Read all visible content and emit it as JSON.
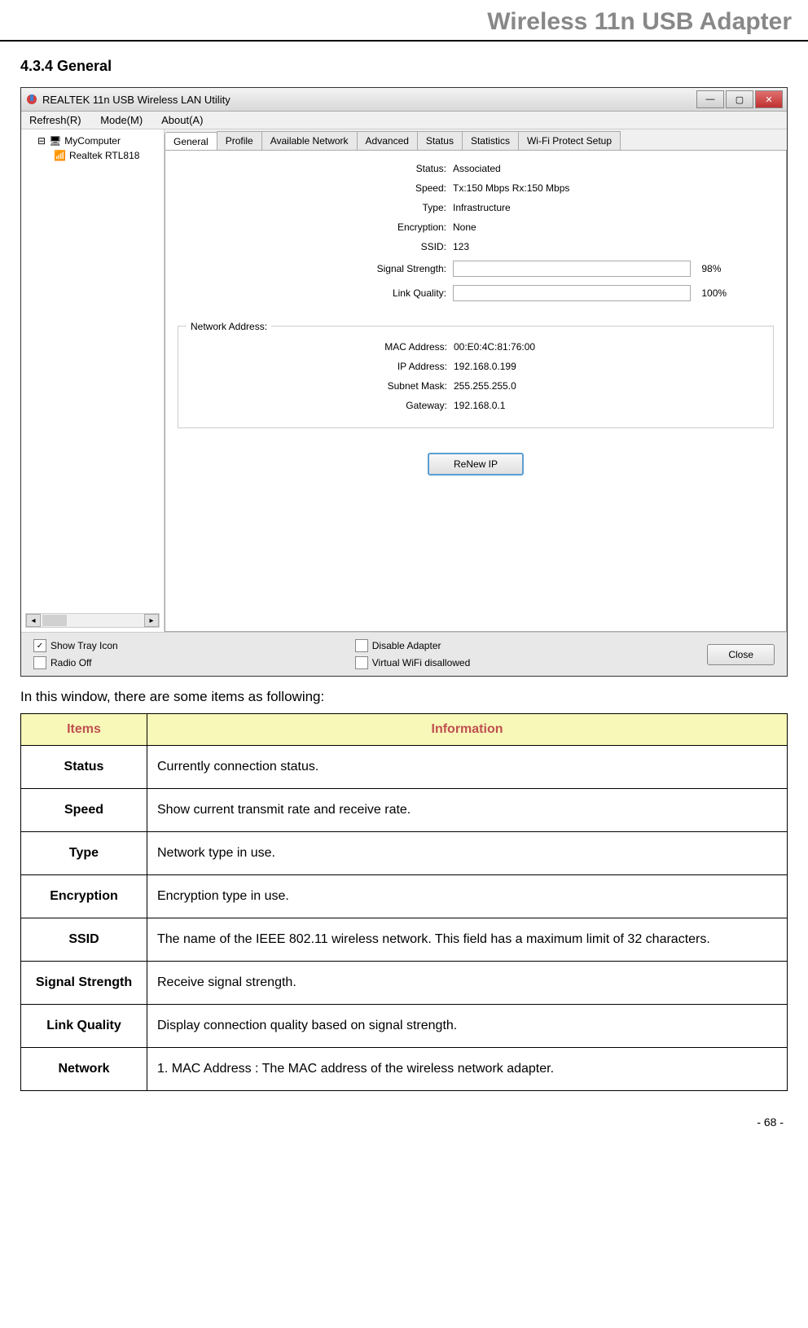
{
  "header": {
    "title": "Wireless 11n USB Adapter"
  },
  "section": {
    "heading": "4.3.4   General"
  },
  "app": {
    "title": "REALTEK 11n USB Wireless LAN Utility",
    "menu": {
      "refresh": "Refresh(R)",
      "mode": "Mode(M)",
      "about": "About(A)"
    },
    "sidebar": {
      "root": "MyComputer",
      "child": "Realtek RTL818"
    },
    "tabs": {
      "general": "General",
      "profile": "Profile",
      "available": "Available Network",
      "advanced": "Advanced",
      "status": "Status",
      "statistics": "Statistics",
      "wps": "Wi-Fi Protect Setup"
    },
    "general": {
      "status_label": "Status:",
      "status_value": "Associated",
      "speed_label": "Speed:",
      "speed_value": "Tx:150 Mbps Rx:150 Mbps",
      "type_label": "Type:",
      "type_value": "Infrastructure",
      "encryption_label": "Encryption:",
      "encryption_value": "None",
      "ssid_label": "SSID:",
      "ssid_value": "123",
      "signal_label": "Signal Strength:",
      "signal_pct": "98%",
      "quality_label": "Link Quality:",
      "quality_pct": "100%",
      "network_address_label": "Network Address:",
      "mac_label": "MAC Address:",
      "mac_value": "00:E0:4C:81:76:00",
      "ip_label": "IP Address:",
      "ip_value": "192.168.0.199",
      "subnet_label": "Subnet Mask:",
      "subnet_value": "255.255.255.0",
      "gateway_label": "Gateway:",
      "gateway_value": "192.168.0.1",
      "renew_button": "ReNew IP"
    },
    "bottom": {
      "show_tray": "Show Tray Icon",
      "radio_off": "Radio Off",
      "disable_adapter": "Disable Adapter",
      "virtual_wifi": "Virtual WiFi disallowed",
      "close_button": "Close"
    }
  },
  "description": "In this window, there are some items as following:",
  "table": {
    "header_items": "Items",
    "header_info": "Information",
    "rows": [
      {
        "item": "Status",
        "info": "Currently connection status."
      },
      {
        "item": "Speed",
        "info": "Show current transmit rate and receive rate."
      },
      {
        "item": "Type",
        "info": "Network type in use."
      },
      {
        "item": "Encryption",
        "info": "Encryption type in use."
      },
      {
        "item": "SSID",
        "info": "The name of the IEEE 802.11 wireless network. This field has a maximum limit of 32 characters."
      },
      {
        "item": "Signal Strength",
        "info": "Receive signal strength."
      },
      {
        "item": "Link Quality",
        "info": "Display connection quality based on signal strength."
      },
      {
        "item": "Network",
        "info": "1. MAC Address : The MAC address of the wireless network adapter."
      }
    ]
  },
  "page_number": "- 68 -"
}
